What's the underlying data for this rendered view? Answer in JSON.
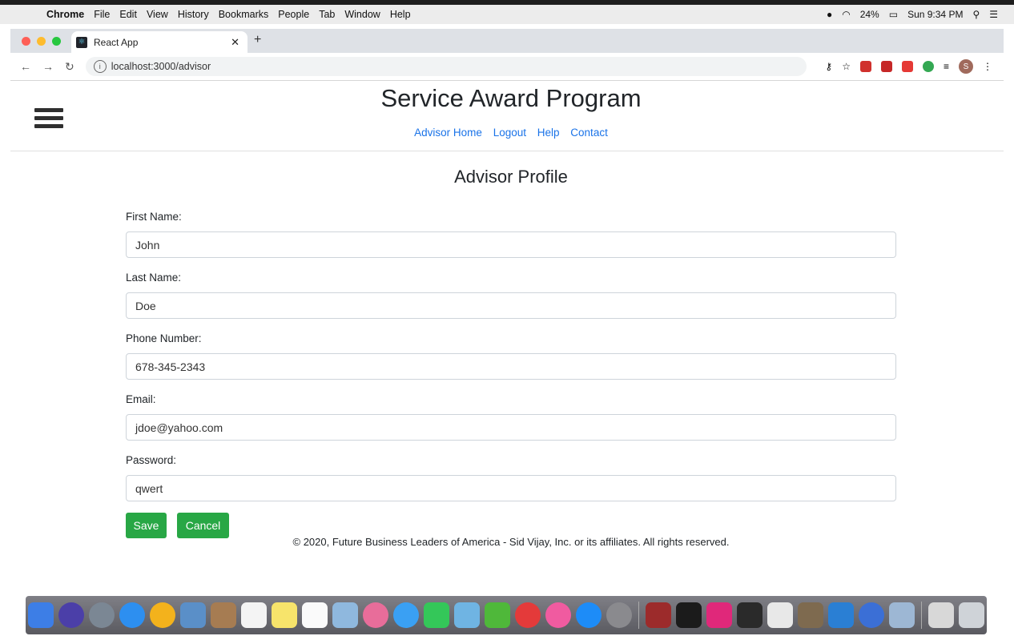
{
  "menubar": {
    "app": "Chrome",
    "items": [
      "File",
      "Edit",
      "View",
      "History",
      "Bookmarks",
      "People",
      "Tab",
      "Window",
      "Help"
    ],
    "battery": "24%",
    "clock": "Sun 9:34 PM"
  },
  "browser": {
    "tab_title": "React App",
    "url": "localhost:3000/advisor",
    "profile_initial": "S"
  },
  "header": {
    "title": "Service Award Program",
    "nav": [
      "Advisor Home",
      "Logout",
      "Help",
      "Contact"
    ]
  },
  "main": {
    "heading": "Advisor Profile",
    "fields": [
      {
        "label": "First Name:",
        "value": "John"
      },
      {
        "label": "Last Name:",
        "value": "Doe"
      },
      {
        "label": "Phone Number:",
        "value": "678-345-2343"
      },
      {
        "label": "Email:",
        "value": "jdoe@yahoo.com"
      },
      {
        "label": "Password:",
        "value": "qwert"
      }
    ],
    "save_label": "Save",
    "cancel_label": "Cancel"
  },
  "footer": {
    "text": "© 2020, Future Business Leaders of America - Sid Vijay, Inc. or its affiliates. All rights reserved."
  },
  "colors": {
    "link": "#1a73e8",
    "button": "#28a745"
  }
}
